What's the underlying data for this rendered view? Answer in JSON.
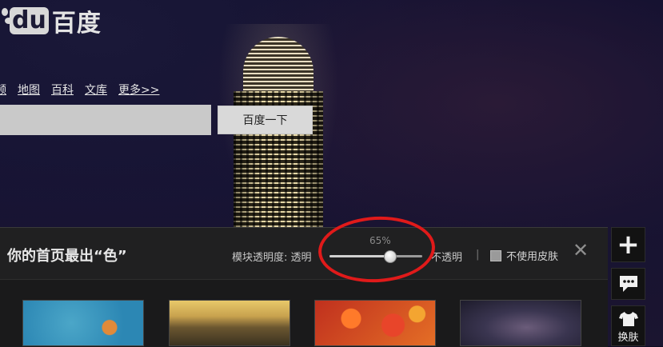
{
  "header": {
    "logo_du": "du",
    "logo_text": "百度"
  },
  "nav": {
    "items": [
      "频",
      "地图",
      "百科",
      "文库",
      "更多>>"
    ]
  },
  "search": {
    "value": "",
    "button_label": "百度一下"
  },
  "skin_panel": {
    "title": "你的首页最出“色”",
    "opacity_label": "模块透明度:",
    "transparent_label": "透明",
    "opaque_label": "不透明",
    "opacity_value": "65%",
    "opacity_fraction": 0.65,
    "divider": "|",
    "no_skin_label": "不使用皮肤",
    "close_symbol": "✕",
    "thumbnails": [
      "blue-water-flower",
      "golden-river-sunset",
      "autumn-red-leaves",
      "starry-night-sky"
    ]
  },
  "sidebar": {
    "add_symbol": "+",
    "skin_label": "换肤"
  },
  "colors": {
    "highlight_ring": "#e01a1a",
    "panel_bg": "#1a1a1b",
    "sky": "#121030"
  }
}
